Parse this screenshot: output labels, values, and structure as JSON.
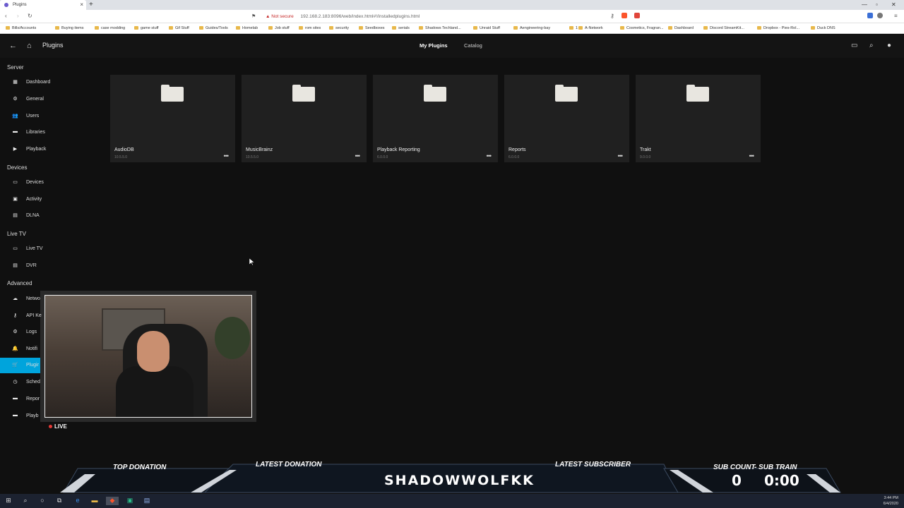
{
  "browser": {
    "tab_title": "Plugins",
    "new_tab": "+",
    "close": "×",
    "not_secure": "Not secure",
    "url": "192.168.2.183:8096/web/index.html#!/installedplugins.html",
    "bookmarks": [
      "Bills/Accounts",
      "Buying items",
      "case modding",
      "game stuff",
      "Gif Stuff",
      "Guides/Tools",
      "Homelab",
      "Job stuff",
      "rom sites",
      "security",
      "Seedboxes",
      "serials",
      "Shadows Techland...",
      "Unraid Stuff",
      "Aengineering-bay",
      "1",
      "A-Network",
      "Cosmetics, Fragran...",
      "Dashboard",
      "Discord StreamKit...",
      "Dropbox - Pies-Rol...",
      "Duck DNS"
    ]
  },
  "app": {
    "title": "Plugins",
    "tabs": [
      "My Plugins",
      "Catalog"
    ],
    "active_tab": 0
  },
  "sidebar": {
    "sections": [
      {
        "title": "Server",
        "items": [
          "Dashboard",
          "General",
          "Users",
          "Libraries",
          "Playback"
        ]
      },
      {
        "title": "Devices",
        "items": [
          "Devices",
          "Activity",
          "DLNA"
        ]
      },
      {
        "title": "Live TV",
        "items": [
          "Live TV",
          "DVR"
        ]
      },
      {
        "title": "Advanced",
        "items": [
          "Netwo",
          "API Ke",
          "Logs",
          "Notifi",
          "Plugir",
          "Sched",
          "Repor",
          "Playb"
        ]
      }
    ],
    "icons": {
      "Dashboard": "▦",
      "General": "⚙",
      "Users": "👥",
      "Libraries": "▬",
      "Playback": "▶",
      "Devices": "▭",
      "Activity": "▣",
      "DLNA": "▤",
      "Live TV": "▭",
      "DVR": "▤",
      "Netwo": "☁",
      "API Ke": "⚷",
      "Logs": "⚙",
      "Notifi": "🔔",
      "Plugir": "🛒",
      "Sched": "◷",
      "Repor": "▬",
      "Playb": "▬"
    },
    "selected": "Plugir"
  },
  "plugins": [
    {
      "name": "AudioDB",
      "version": "10.5.5.0"
    },
    {
      "name": "MusicBrainz",
      "version": "10.5.5.0"
    },
    {
      "name": "Playback Reporting",
      "version": "6.0.0.0"
    },
    {
      "name": "Reports",
      "version": "6.0.0.0"
    },
    {
      "name": "Trakt",
      "version": "9.0.0.0"
    }
  ],
  "overlay": {
    "live": "LIVE",
    "top_donation": "TOP DONATION",
    "latest_donation": "LATEST DONATION",
    "latest_subscriber": "LATEST SUBSCRIBER",
    "sub_count": "SUB COUNT",
    "sub_train": "SUB TRAIN",
    "subscriber_name": "SHADOWWOLFKK",
    "sub_count_value": "0",
    "sub_train_value": "0:00"
  },
  "taskbar": {
    "time": "3:44 PM",
    "date": "6/4/2020"
  },
  "colors": {
    "accent": "#00a4dc",
    "background": "#101010",
    "card": "#202020"
  }
}
